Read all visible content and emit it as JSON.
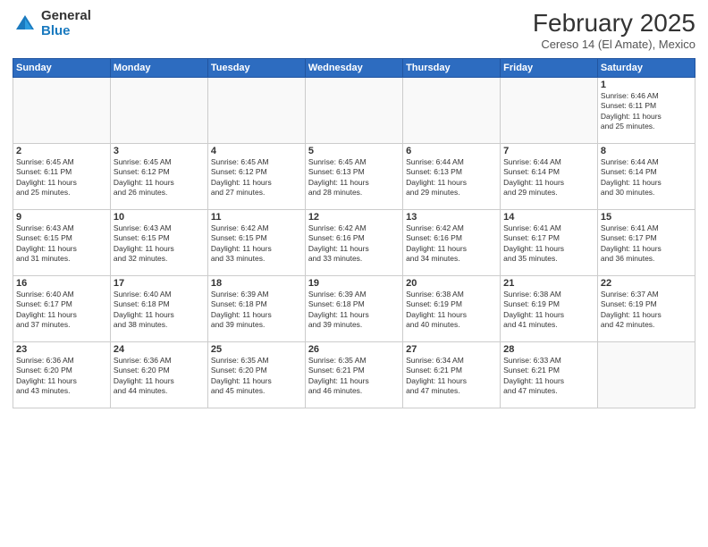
{
  "header": {
    "logo_general": "General",
    "logo_blue": "Blue",
    "month_title": "February 2025",
    "location": "Cereso 14 (El Amate), Mexico"
  },
  "days_of_week": [
    "Sunday",
    "Monday",
    "Tuesday",
    "Wednesday",
    "Thursday",
    "Friday",
    "Saturday"
  ],
  "weeks": [
    [
      {
        "day": "",
        "info": ""
      },
      {
        "day": "",
        "info": ""
      },
      {
        "day": "",
        "info": ""
      },
      {
        "day": "",
        "info": ""
      },
      {
        "day": "",
        "info": ""
      },
      {
        "day": "",
        "info": ""
      },
      {
        "day": "1",
        "info": "Sunrise: 6:46 AM\nSunset: 6:11 PM\nDaylight: 11 hours\nand 25 minutes."
      }
    ],
    [
      {
        "day": "2",
        "info": "Sunrise: 6:45 AM\nSunset: 6:11 PM\nDaylight: 11 hours\nand 25 minutes."
      },
      {
        "day": "3",
        "info": "Sunrise: 6:45 AM\nSunset: 6:12 PM\nDaylight: 11 hours\nand 26 minutes."
      },
      {
        "day": "4",
        "info": "Sunrise: 6:45 AM\nSunset: 6:12 PM\nDaylight: 11 hours\nand 27 minutes."
      },
      {
        "day": "5",
        "info": "Sunrise: 6:45 AM\nSunset: 6:13 PM\nDaylight: 11 hours\nand 28 minutes."
      },
      {
        "day": "6",
        "info": "Sunrise: 6:44 AM\nSunset: 6:13 PM\nDaylight: 11 hours\nand 29 minutes."
      },
      {
        "day": "7",
        "info": "Sunrise: 6:44 AM\nSunset: 6:14 PM\nDaylight: 11 hours\nand 29 minutes."
      },
      {
        "day": "8",
        "info": "Sunrise: 6:44 AM\nSunset: 6:14 PM\nDaylight: 11 hours\nand 30 minutes."
      }
    ],
    [
      {
        "day": "9",
        "info": "Sunrise: 6:43 AM\nSunset: 6:15 PM\nDaylight: 11 hours\nand 31 minutes."
      },
      {
        "day": "10",
        "info": "Sunrise: 6:43 AM\nSunset: 6:15 PM\nDaylight: 11 hours\nand 32 minutes."
      },
      {
        "day": "11",
        "info": "Sunrise: 6:42 AM\nSunset: 6:15 PM\nDaylight: 11 hours\nand 33 minutes."
      },
      {
        "day": "12",
        "info": "Sunrise: 6:42 AM\nSunset: 6:16 PM\nDaylight: 11 hours\nand 33 minutes."
      },
      {
        "day": "13",
        "info": "Sunrise: 6:42 AM\nSunset: 6:16 PM\nDaylight: 11 hours\nand 34 minutes."
      },
      {
        "day": "14",
        "info": "Sunrise: 6:41 AM\nSunset: 6:17 PM\nDaylight: 11 hours\nand 35 minutes."
      },
      {
        "day": "15",
        "info": "Sunrise: 6:41 AM\nSunset: 6:17 PM\nDaylight: 11 hours\nand 36 minutes."
      }
    ],
    [
      {
        "day": "16",
        "info": "Sunrise: 6:40 AM\nSunset: 6:17 PM\nDaylight: 11 hours\nand 37 minutes."
      },
      {
        "day": "17",
        "info": "Sunrise: 6:40 AM\nSunset: 6:18 PM\nDaylight: 11 hours\nand 38 minutes."
      },
      {
        "day": "18",
        "info": "Sunrise: 6:39 AM\nSunset: 6:18 PM\nDaylight: 11 hours\nand 39 minutes."
      },
      {
        "day": "19",
        "info": "Sunrise: 6:39 AM\nSunset: 6:18 PM\nDaylight: 11 hours\nand 39 minutes."
      },
      {
        "day": "20",
        "info": "Sunrise: 6:38 AM\nSunset: 6:19 PM\nDaylight: 11 hours\nand 40 minutes."
      },
      {
        "day": "21",
        "info": "Sunrise: 6:38 AM\nSunset: 6:19 PM\nDaylight: 11 hours\nand 41 minutes."
      },
      {
        "day": "22",
        "info": "Sunrise: 6:37 AM\nSunset: 6:19 PM\nDaylight: 11 hours\nand 42 minutes."
      }
    ],
    [
      {
        "day": "23",
        "info": "Sunrise: 6:36 AM\nSunset: 6:20 PM\nDaylight: 11 hours\nand 43 minutes."
      },
      {
        "day": "24",
        "info": "Sunrise: 6:36 AM\nSunset: 6:20 PM\nDaylight: 11 hours\nand 44 minutes."
      },
      {
        "day": "25",
        "info": "Sunrise: 6:35 AM\nSunset: 6:20 PM\nDaylight: 11 hours\nand 45 minutes."
      },
      {
        "day": "26",
        "info": "Sunrise: 6:35 AM\nSunset: 6:21 PM\nDaylight: 11 hours\nand 46 minutes."
      },
      {
        "day": "27",
        "info": "Sunrise: 6:34 AM\nSunset: 6:21 PM\nDaylight: 11 hours\nand 47 minutes."
      },
      {
        "day": "28",
        "info": "Sunrise: 6:33 AM\nSunset: 6:21 PM\nDaylight: 11 hours\nand 47 minutes."
      },
      {
        "day": "",
        "info": ""
      }
    ]
  ]
}
